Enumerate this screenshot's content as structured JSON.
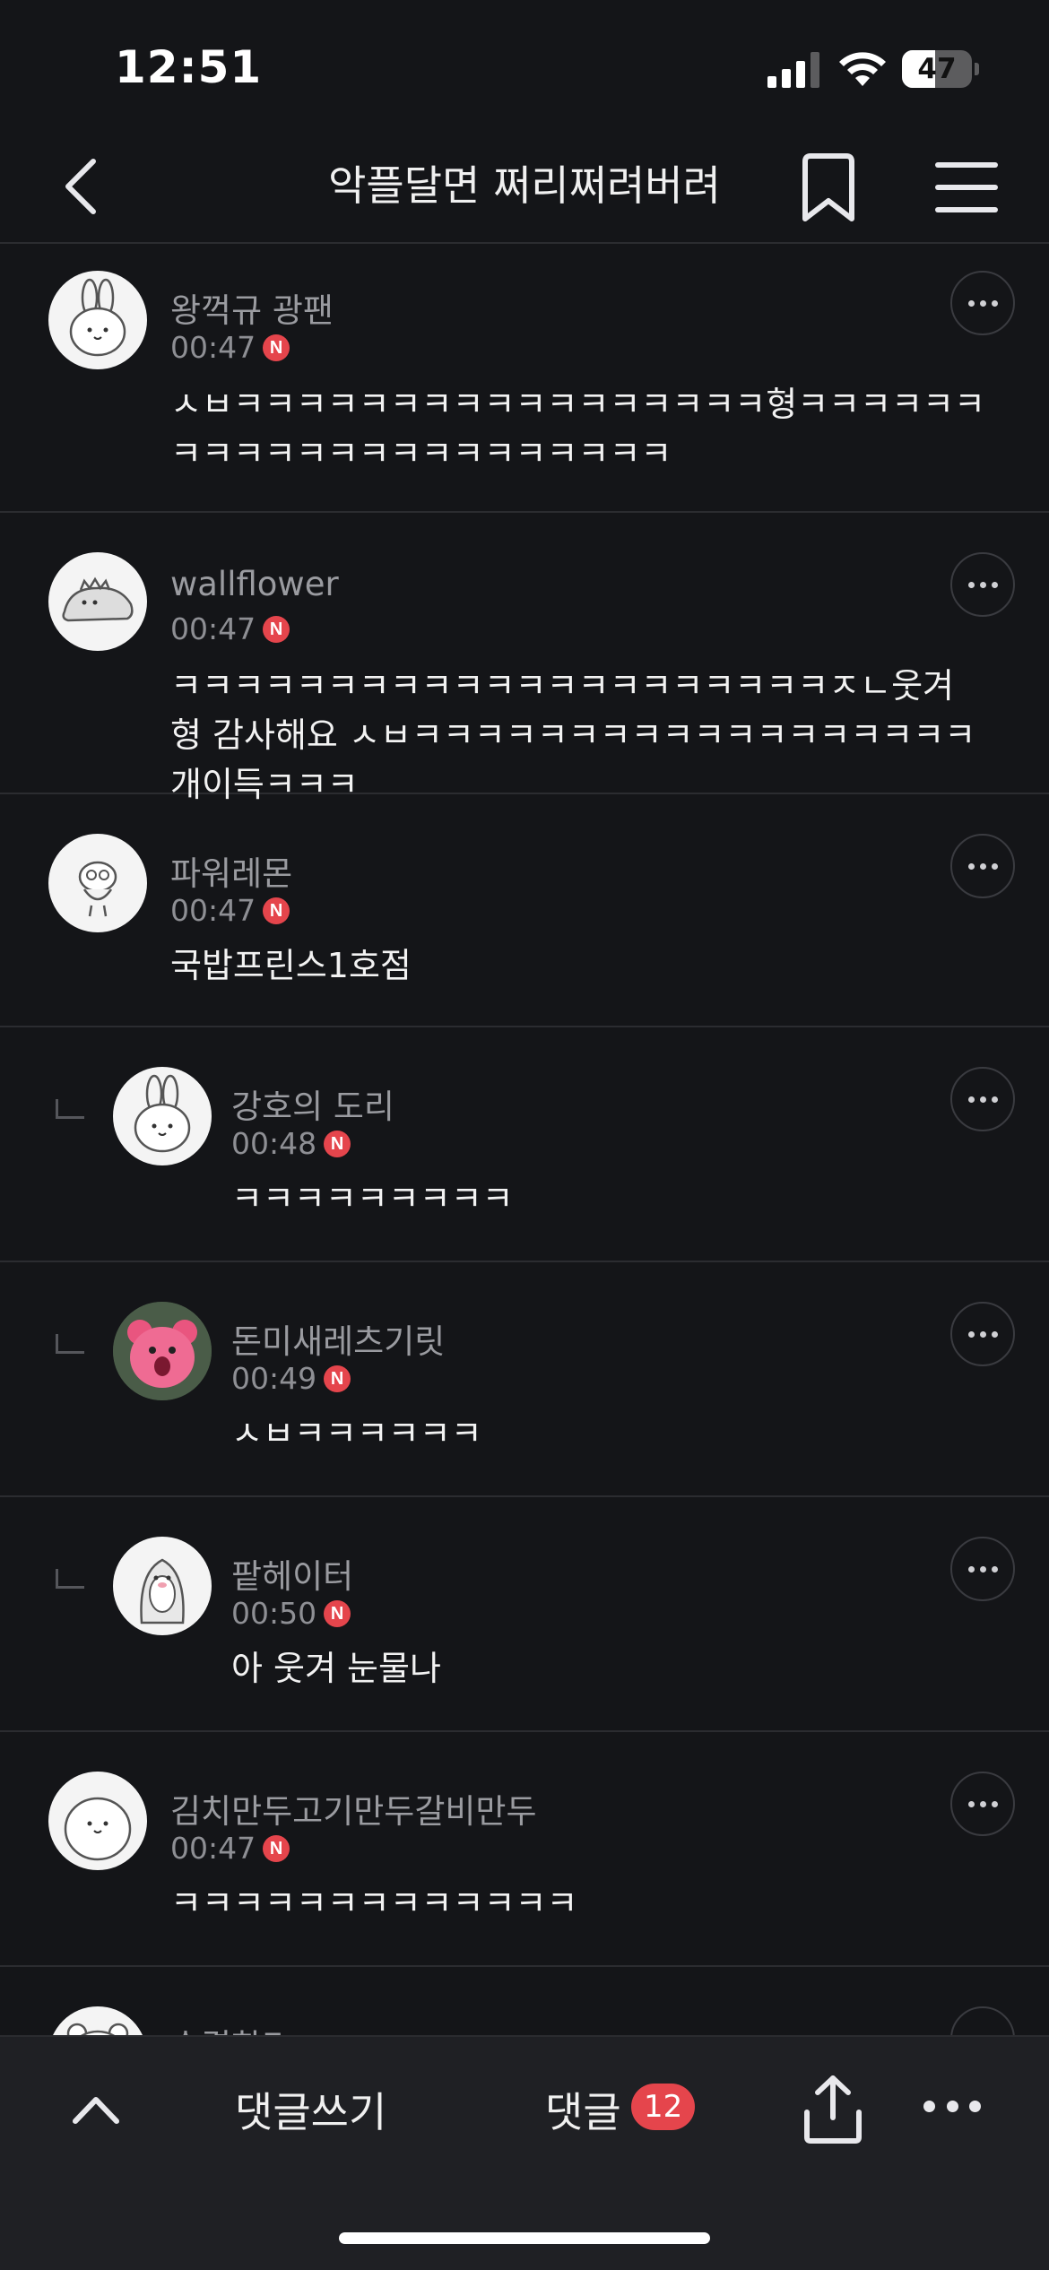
{
  "status_bar": {
    "time": "12:51",
    "battery_level": "47",
    "battery_fraction": 0.47
  },
  "nav": {
    "title": "악플달면 쩌리쩌려버려",
    "back_icon": "chevron-left-icon",
    "bookmark_icon": "bookmark-icon",
    "menu_icon": "hamburger-menu-icon"
  },
  "comments": [
    {
      "nickname": "왕꺽규 광팬",
      "time": "00:47",
      "badge": "N",
      "text": "ㅅㅂㅋㅋㅋㅋㅋㅋㅋㅋㅋㅋㅋㅋㅋㅋㅋㅋㅋ형ㅋㅋㅋㅋㅋㅋㅋㅋㅋㅋㅋㅋㅋㅋㅋㅋㅋㅋㅋㅋㅋㅋ",
      "is_reply": false,
      "avatar": "rabbit-avatar-icon"
    },
    {
      "nickname": "wallflower",
      "time": "00:47",
      "badge": "N",
      "text": "ㅋㅋㅋㅋㅋㅋㅋㅋㅋㅋㅋㅋㅋㅋㅋㅋㅋㅋㅋㅋㅋㅈㄴ웃겨 형 감사해요 ㅅㅂㅋㅋㅋㅋㅋㅋㅋㅋㅋㅋㅋㅋㅋㅋㅋㅋㅋㅋ개이득ㅋㅋㅋ",
      "is_reply": false,
      "avatar": "dinosaur-avatar-icon"
    },
    {
      "nickname": "파워레몬",
      "time": "00:47",
      "badge": "N",
      "text": "국밥프린스1호점",
      "is_reply": false,
      "avatar": "character-avatar-icon"
    },
    {
      "nickname": "강호의 도리",
      "time": "00:48",
      "badge": "N",
      "text": "ㅋㅋㅋㅋㅋㅋㅋㅋㅋ",
      "is_reply": true,
      "avatar": "rabbit-avatar-icon"
    },
    {
      "nickname": "돈미새레츠기릿",
      "time": "00:49",
      "badge": "N",
      "text": "ㅅㅂㅋㅋㅋㅋㅋㅋ",
      "is_reply": true,
      "avatar": "pink-bear-avatar-icon"
    },
    {
      "nickname": "팥헤이터",
      "time": "00:50",
      "badge": "N",
      "text": "아 웃겨 눈물나",
      "is_reply": true,
      "avatar": "penguin-avatar-icon"
    },
    {
      "nickname": "김치만두고기만두갈비만두",
      "time": "00:47",
      "badge": "N",
      "text": "ㅋㅋㅋㅋㅋㅋㅋㅋㅋㅋㅋㅋㅋ",
      "is_reply": false,
      "avatar": "blob-avatar-icon"
    },
    {
      "nickname": "순결한E",
      "time": "",
      "badge": "",
      "text": "",
      "is_reply": false,
      "avatar": "bear-avatar-icon"
    }
  ],
  "bottom_bar": {
    "up_icon": "chevron-up-icon",
    "write_label": "댓글쓰기",
    "comments_label": "댓글",
    "comment_count": "12",
    "share_icon": "share-icon",
    "more_icon": "more-dots-icon"
  },
  "colors": {
    "background": "#141518",
    "badge_red": "#e5454c",
    "muted_text": "#9a9ba0"
  }
}
